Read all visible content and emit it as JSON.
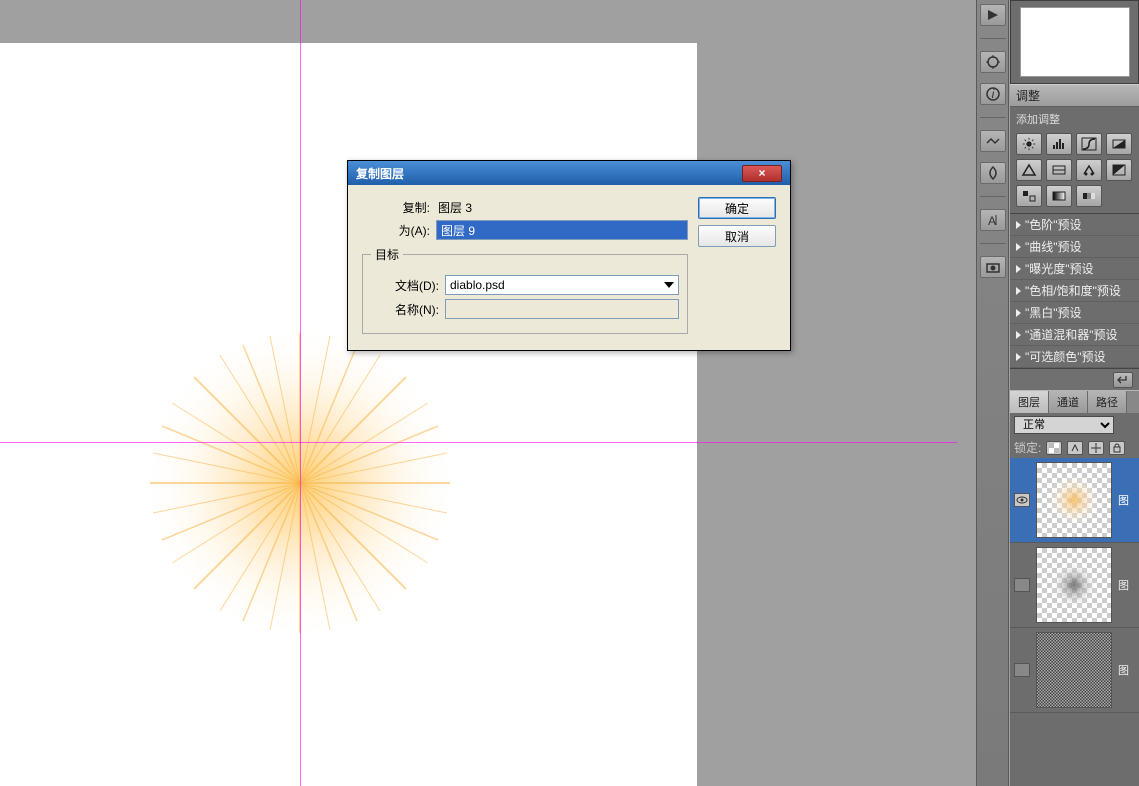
{
  "dialog": {
    "title": "复制图层",
    "copy_label": "复制:",
    "copy_value": "图层 3",
    "as_label": "为(A):",
    "as_value": "图层 9",
    "target_legend": "目标",
    "doc_label": "文档(D):",
    "doc_value": "diablo.psd",
    "name_label": "名称(N):",
    "name_value": "",
    "ok": "确定",
    "cancel": "取消",
    "close_glyph": "×"
  },
  "adjust": {
    "header": "调整",
    "add_label": "添加调整",
    "presets": [
      "\"色阶\"预设",
      "\"曲线\"预设",
      "\"曝光度\"预设",
      "\"色相/饱和度\"预设",
      "\"黑白\"预设",
      "\"通道混和器\"预设",
      "\"可选颜色\"预设"
    ]
  },
  "layers": {
    "tabs": [
      "图层",
      "通道",
      "路径"
    ],
    "blend_mode": "正常",
    "lock_label": "锁定:",
    "items": [
      {
        "label": "图",
        "visible": true,
        "type": "burst",
        "active": true
      },
      {
        "label": "图",
        "visible": false,
        "type": "radial",
        "active": false
      },
      {
        "label": "图",
        "visible": false,
        "type": "noise",
        "active": false
      }
    ]
  }
}
